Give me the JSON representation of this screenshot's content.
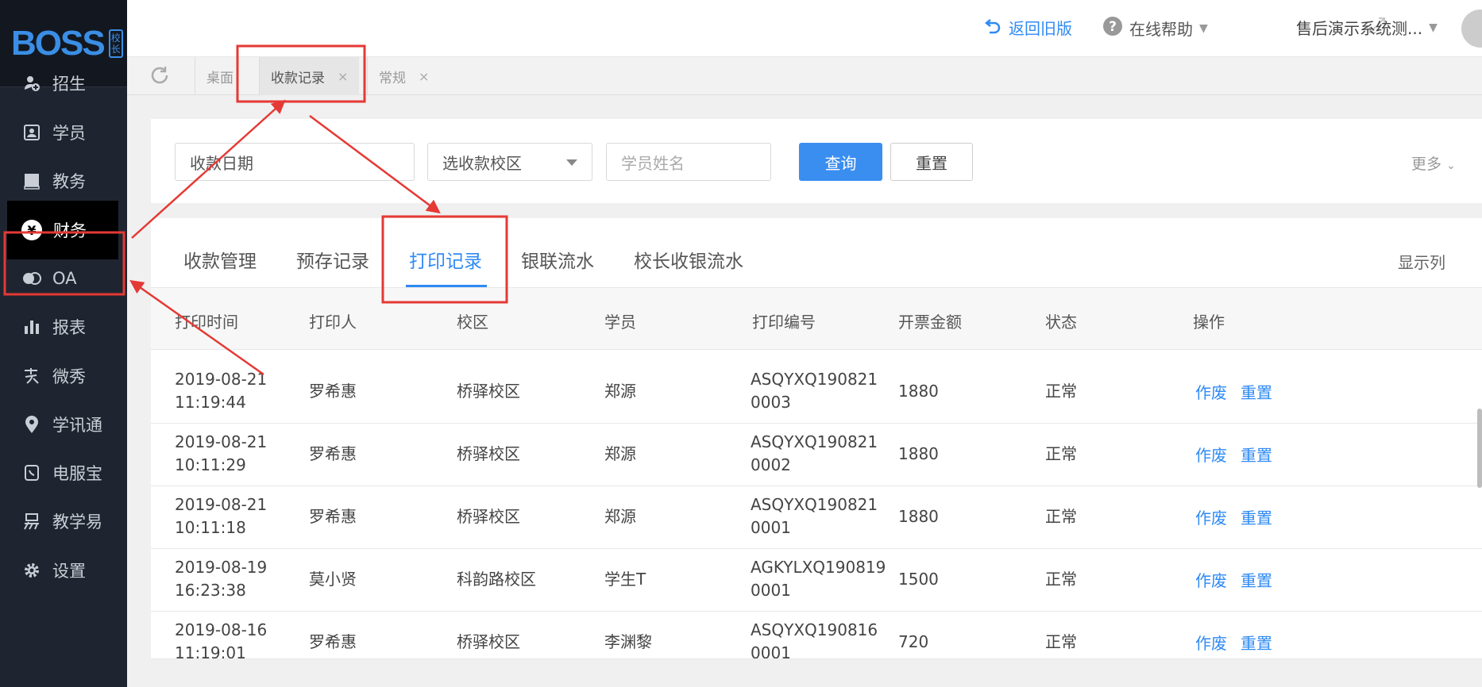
{
  "logo": {
    "text": "BOSS",
    "badge": "校长"
  },
  "sidebar": {
    "items": [
      {
        "label": "招生",
        "icon": "user-plus-icon"
      },
      {
        "label": "学员",
        "icon": "id-card-icon"
      },
      {
        "label": "教务",
        "icon": "book-icon"
      },
      {
        "label": "财务",
        "icon": "yen-icon",
        "glyph": "¥",
        "active": true
      },
      {
        "label": "OA",
        "icon": "oa-icon"
      },
      {
        "label": "报表",
        "icon": "bar-chart-icon"
      },
      {
        "label": "微秀",
        "icon": "xiu-icon"
      },
      {
        "label": "学讯通",
        "icon": "location-pin-icon"
      },
      {
        "label": "电服宝",
        "icon": "phone-icon"
      },
      {
        "label": "教学易",
        "icon": "yi-icon"
      },
      {
        "label": "设置",
        "icon": "gear-icon"
      }
    ]
  },
  "header": {
    "back_old": "返回旧版",
    "help": "在线帮助",
    "user": "售后演示系统测..."
  },
  "tabs": [
    {
      "label": "桌面"
    },
    {
      "label": "收款记录",
      "close": "×",
      "active": true
    },
    {
      "label": "常规",
      "close": "×"
    }
  ],
  "filters": {
    "date": "收款日期",
    "campus": "选收款校区",
    "student_placeholder": "学员姓名",
    "query": "查询",
    "reset": "重置",
    "more": "更多"
  },
  "subtabs": [
    "收款管理",
    "预存记录",
    "打印记录",
    "银联流水",
    "校长收银流水"
  ],
  "active_subtab": "打印记录",
  "show_columns": "显示列",
  "table": {
    "columns": [
      "打印时间",
      "打印人",
      "校区",
      "学员",
      "打印编号",
      "开票金额",
      "状态",
      "操作"
    ],
    "rows": [
      {
        "date": "2019-08-21",
        "time": "11:19:44",
        "printer": "罗希惠",
        "campus": "桥驿校区",
        "student": "郑源",
        "code1": "ASQYXQ190821",
        "code2": "0003",
        "amount": "1880",
        "status": "正常",
        "op1": "作废",
        "op2": "重置"
      },
      {
        "date": "2019-08-21",
        "time": "10:11:29",
        "printer": "罗希惠",
        "campus": "桥驿校区",
        "student": "郑源",
        "code1": "ASQYXQ190821",
        "code2": "0002",
        "amount": "1880",
        "status": "正常",
        "op1": "作废",
        "op2": "重置"
      },
      {
        "date": "2019-08-21",
        "time": "10:11:18",
        "printer": "罗希惠",
        "campus": "桥驿校区",
        "student": "郑源",
        "code1": "ASQYXQ190821",
        "code2": "0001",
        "amount": "1880",
        "status": "正常",
        "op1": "作废",
        "op2": "重置"
      },
      {
        "date": "2019-08-19",
        "time": "16:23:38",
        "printer": "莫小贤",
        "campus": "科韵路校区",
        "student": "学生T",
        "code1": "AGKYLXQ190819",
        "code2": "0001",
        "amount": "1500",
        "status": "正常",
        "op1": "作废",
        "op2": "重置"
      },
      {
        "date": "2019-08-16",
        "time": "11:19:01",
        "printer": "罗希惠",
        "campus": "桥驿校区",
        "student": "李渊黎",
        "code1": "ASQYXQ190816",
        "code2": "0001",
        "amount": "720",
        "status": "正常",
        "op1": "作废",
        "op2": "重置"
      }
    ]
  },
  "colors": {
    "sidebar_bg": "#1f2530",
    "accent": "#2f8af5",
    "annotation_red": "#e53935"
  }
}
